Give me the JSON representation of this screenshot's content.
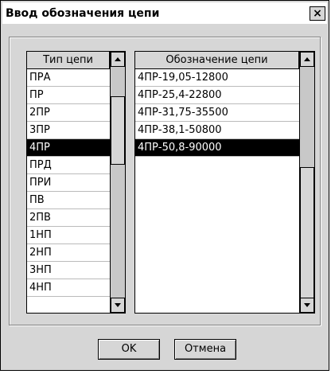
{
  "window": {
    "title": "Ввод обозначения цепи",
    "close_glyph": "×"
  },
  "left_list": {
    "header": "Тип цепи",
    "items": [
      "ПРА",
      "ПР",
      "2ПР",
      "3ПР",
      "4ПР",
      "ПРД",
      "ПРИ",
      "ПВ",
      "2ПВ",
      "1НП",
      "2НП",
      "3НП",
      "4НП"
    ],
    "selected": "4ПР"
  },
  "right_list": {
    "header": "Обозначение цепи",
    "items": [
      "4ПР-19,05-12800",
      "4ПР-25,4-22800",
      "4ПР-31,75-35500",
      "4ПР-38,1-50800",
      "4ПР-50,8-90000"
    ],
    "selected": "4ПР-50,8-90000"
  },
  "buttons": {
    "ok": "OK",
    "cancel": "Отмена"
  }
}
